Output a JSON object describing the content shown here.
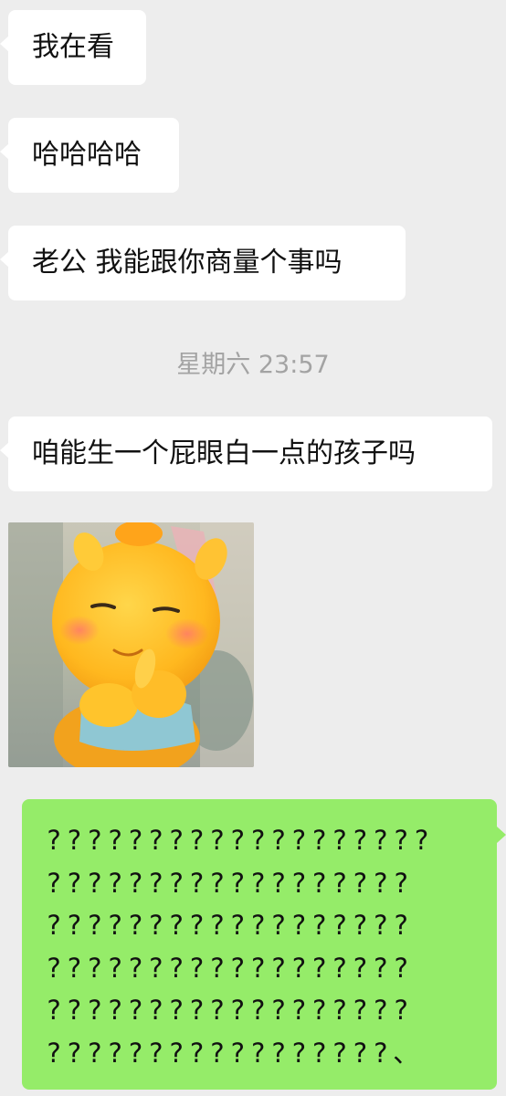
{
  "messages": {
    "m1": "我在看",
    "m2": "哈哈哈哈",
    "m3": "老公 我能跟你商量个事吗",
    "timestamp": "星期六 23:57",
    "m4": "咱能生一个屁眼白一点的孩子吗",
    "sticker": {
      "icon": "cartoon-yellow-creature-sticker"
    },
    "reply_lines": [
      "???????????????????",
      "??????????????????",
      "??????????????????",
      "??????????????????",
      "??????????????????",
      "?????????????????、"
    ]
  },
  "colors": {
    "background": "#ededed",
    "incoming_bubble": "#ffffff",
    "outgoing_bubble": "#95ec69",
    "timestamp_text": "#a3a3a3"
  }
}
